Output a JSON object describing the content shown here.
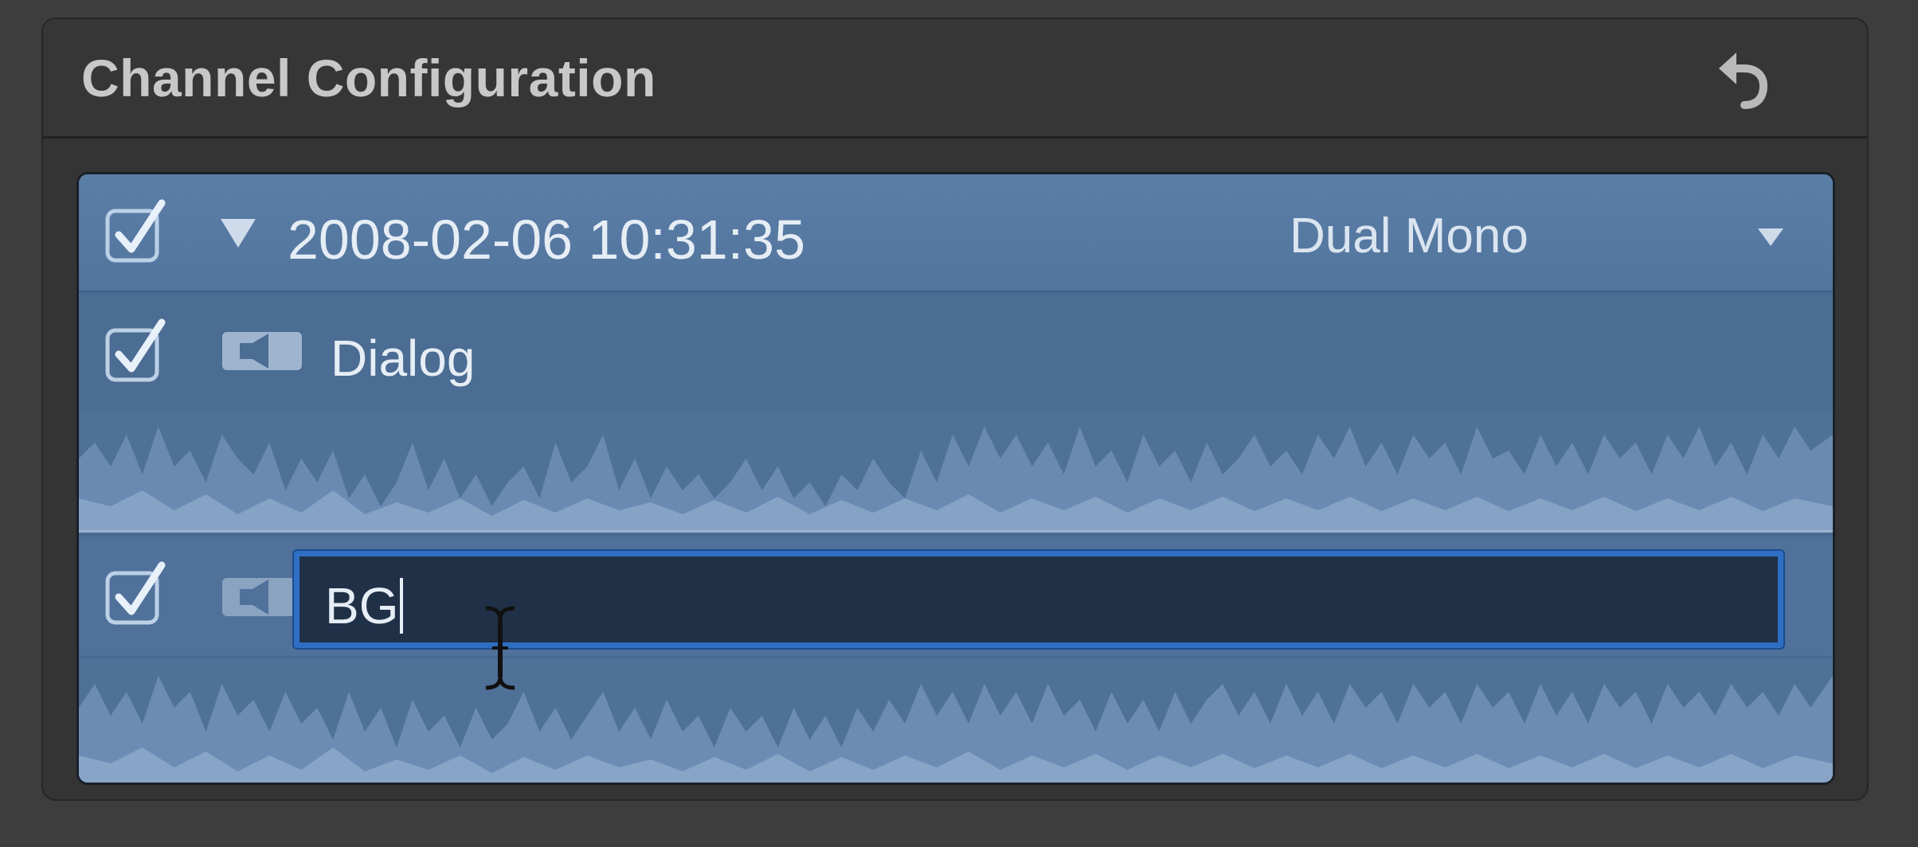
{
  "panel": {
    "title": "Channel Configuration",
    "undo_icon": "undo-arrow-icon"
  },
  "clip": {
    "checked": true,
    "expanded": true,
    "name": "2008-02-06 10:31:35",
    "configuration": "Dual Mono"
  },
  "channels": [
    {
      "checked": true,
      "label": "Dialog",
      "editing": false
    },
    {
      "checked": true,
      "label": "BG",
      "editing": true
    }
  ],
  "colors": {
    "panel_bg": "#343434",
    "clip_row": "#5b7ea7",
    "channel_bg": "#4a6b91",
    "field_border": "#2e6fc4",
    "field_bg": "#203047",
    "text": "#e6edf5"
  }
}
